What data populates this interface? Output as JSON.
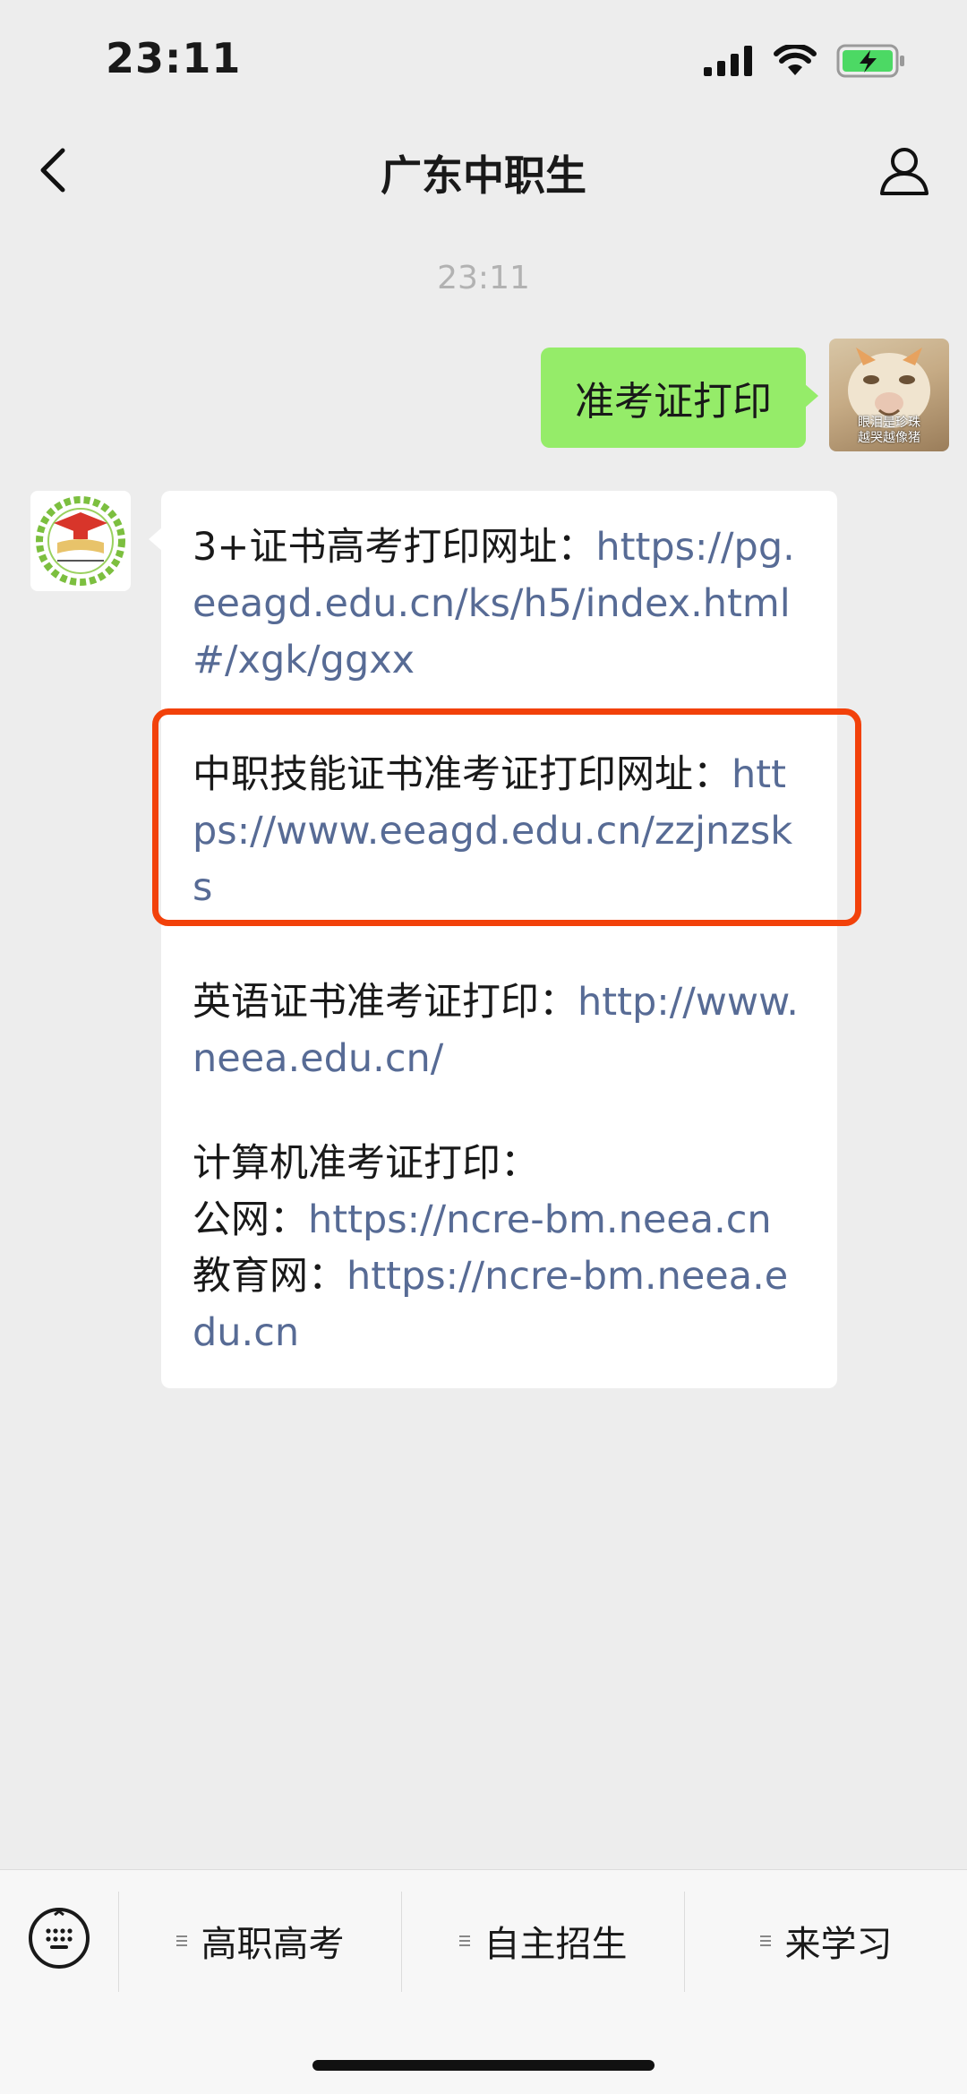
{
  "status_bar": {
    "time": "23:11"
  },
  "nav": {
    "title": "广东中职生"
  },
  "chat": {
    "timestamp": "23:11",
    "sent_message": "准考证打印",
    "my_avatar_caption_line1": "眼泪是珍珠",
    "my_avatar_caption_line2": "越哭越像猪",
    "reply": {
      "p1_label": "3+证书高考打印网址：",
      "p1_link": "https://pg.eeagd.edu.cn/ks/h5/index.html#/xgk/ggxx",
      "p2_label": "中职技能证书准考证打印网址：",
      "p2_link": "https://www.eeagd.edu.cn/zzjnzsks",
      "p3_label": "英语证书准考证打印：",
      "p3_link": "http://www.neea.edu.cn/",
      "p4_heading": "计算机准考证打印：",
      "p4_line1_label": "公网：",
      "p4_line1_link": "https://ncre-bm.neea.cn",
      "p4_line2_label": "教育网：",
      "p4_line2_link": "https://ncre-bm.neea.edu.cn"
    }
  },
  "menu": {
    "items": [
      {
        "label": "高职高考"
      },
      {
        "label": "自主招生"
      },
      {
        "label": "来学习"
      }
    ]
  },
  "colors": {
    "sent_bubble": "#95ec69",
    "link": "#576b95",
    "highlight": "#f2410a"
  },
  "icons": [
    "back-arrow-icon",
    "profile-icon",
    "keyboard-icon",
    "signal-icon",
    "wifi-icon",
    "battery-icon"
  ]
}
